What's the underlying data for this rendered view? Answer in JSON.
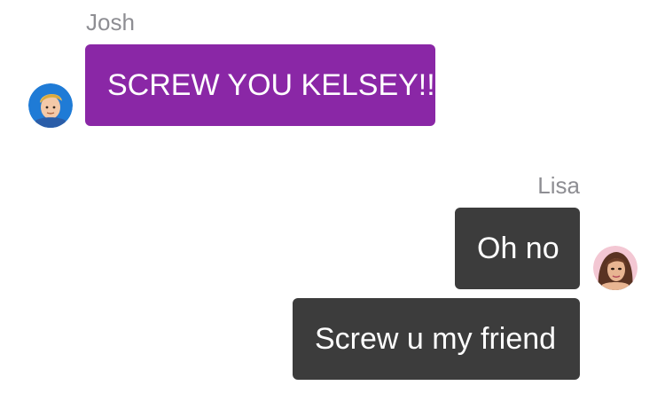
{
  "conversation": {
    "messages": [
      {
        "sender": "Josh",
        "direction": "incoming",
        "avatar_icon": "cartoon-boy-avatar-icon",
        "text": "SCREW YOU KELSEY!!"
      },
      {
        "sender": "Lisa",
        "direction": "outgoing",
        "avatar_icon": "cartoon-girl-avatar-icon",
        "text": "Oh no"
      },
      {
        "sender": "Lisa",
        "direction": "outgoing",
        "text": "Screw u my friend"
      }
    ]
  },
  "colors": {
    "incoming_bubble": "#8a27a6",
    "outgoing_bubble": "#3c3c3c",
    "sender_name": "#8e8e93",
    "background": "#ffffff"
  }
}
